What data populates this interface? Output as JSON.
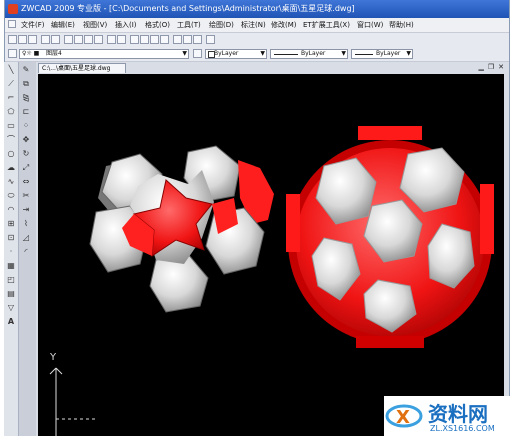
{
  "app": {
    "title": "ZWCAD 2009 专业版 - [C:\\Documents and Settings\\Administrator\\桌面\\五星足球.dwg]"
  },
  "menu": [
    "文件(F)",
    "编辑(E)",
    "视图(V)",
    "插入(I)",
    "格式(O)",
    "工具(T)",
    "绘图(D)",
    "标注(N)",
    "修改(M)",
    "ET扩展工具(X)",
    "窗口(W)",
    "帮助(H)"
  ],
  "layer_toolbar": {
    "layer_name": "图层4",
    "color_value": "ByLayer",
    "linetype_value": "ByLayer",
    "lineweight_value": "ByLayer"
  },
  "document_tab": {
    "label": "C:\\...\\桌面\\五星足球.dwg"
  },
  "ucs": {
    "y_label": "Y"
  },
  "watermark": {
    "brand": "资料网",
    "url": "ZL.XS1616.COM"
  },
  "colors": {
    "title_bar": "#2a61c6",
    "canvas": "#000000",
    "red": "#ff1010",
    "white": "#f4f4f4"
  }
}
